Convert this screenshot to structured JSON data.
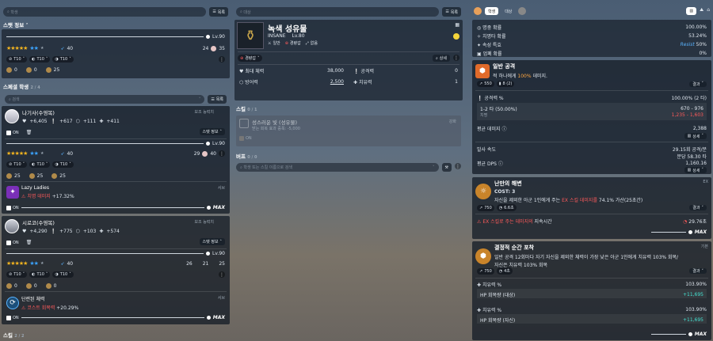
{
  "col1": {
    "search_placeholder": "학생",
    "list_btn": "목록",
    "stat_info_title": "스탯 정보",
    "level": "Lv.90",
    "bond": "40",
    "gift1": "24",
    "gift2": "35",
    "tier1": "T10",
    "tier2": "T10",
    "tier3": "T10",
    "equip_vals": [
      "0",
      "0",
      "25"
    ],
    "special_title": "스페셜 학생",
    "special_count": "2 / 4",
    "search2_placeholder": "검색",
    "list_btn2": "목록",
    "s1": {
      "name": "나기사(수영복)",
      "role": "보조 능력치",
      "stats": [
        "+6,405",
        "+617",
        "+111",
        "+411"
      ],
      "stat_btn": "스탯 정보",
      "on": "ON",
      "level": "Lv.90",
      "bond": "40",
      "gift1": "29",
      "gift2": "40",
      "tiers": [
        "T10",
        "T10",
        "T10"
      ],
      "equip": [
        "25",
        "25",
        "25"
      ],
      "skill_name": "Lazy Ladies",
      "skill_type": "서브",
      "skill_line1": "치명 데미지",
      "skill_line2": "+17.32%",
      "max": "MAX"
    },
    "s2": {
      "name": "시로코(수영복)",
      "role": "보조 능력치",
      "stats": [
        "+4,290",
        "+775",
        "+103",
        "+574"
      ],
      "stat_btn": "스탯 정보",
      "on": "ON",
      "level": "Lv.90",
      "bond": "40",
      "gift1": "26",
      "gift2": "21",
      "gift3": "25",
      "tiers": [
        "T10",
        "T10",
        "T10"
      ],
      "equip": [
        "0",
        "0",
        "0"
      ],
      "skill_name": "단련된 체력",
      "skill_type": "서브",
      "skill_line1": "코스트 회복력",
      "skill_line2": "+20.29%",
      "max": "MAX"
    },
    "skill_footer": "스킬",
    "skill_footer_count": "2 / 2"
  },
  "col2": {
    "search_placeholder": "대상",
    "list_btn": "목록",
    "name": "녹색 성유물",
    "diff": "INSANE",
    "level": "Lv.80",
    "tag1": "일반",
    "tag2": "경량갑",
    "tag3": "없음",
    "armor_tag": "경량갑",
    "detail_btn": "상세",
    "hp_label": "최대 체력",
    "hp_val": "38,000",
    "atk_label": "공격력",
    "atk_val": "0",
    "def_label": "방어력",
    "def_val": "2,500",
    "heal_label": "치유력",
    "heal_val": "1",
    "skill_title": "스킬",
    "skill_count": "0 / 1",
    "skill_name": "성스러운 빛 (성유물)",
    "skill_tag": "강화",
    "skill_desc": "받는 회복 효과 증폭: -5,000",
    "skill_on": "ON",
    "buff_title": "버프",
    "buff_count": "0 / 0",
    "buff_placeholder": "학생 또는 스킬 이름으로 검색"
  },
  "col3": {
    "tab1": "학생",
    "tab2": "대상",
    "stats": [
      {
        "label": "명중 확률",
        "value": "100.00%"
      },
      {
        "label": "치명타 확률",
        "value": "53.24%"
      },
      {
        "label": "속성 특효",
        "extra": "Resist",
        "value": "50%"
      },
      {
        "label": "엄폐 확률",
        "value": "0%"
      }
    ],
    "normal": {
      "title": "일반 공격",
      "desc_pre": "적 하나에게 ",
      "desc_hl": "100%",
      "desc_post": " 데미지.",
      "v1": "550",
      "v2": "8 (2)",
      "result": "결과",
      "acc_label": "공격력 %",
      "acc_val": "100.00% (2 타)",
      "hit_label": "1-2 타 (50.00%)",
      "hit_val": "670 - 976",
      "crit_label": "치명",
      "crit_val": "1,235 - 1,603",
      "avg_label": "평균 데미지",
      "avg_val": "2,388",
      "detail": "상세",
      "rate_label": "발사 속도",
      "rate_val": "29.15회 공격/분",
      "rate_val2": "분당 58.30 타",
      "dps_label": "평균 DPS",
      "dps_val": "1,160.16"
    },
    "ex": {
      "title": "난만의 해변",
      "type": "EX",
      "cost": "COST: 3",
      "desc": "자신을 제외한 아군 1인에게 주는",
      "desc2": "EX 스킬 데미지를",
      "desc3": "74.1% 가산(25초간)",
      "v1": "750",
      "v2": "6.6초",
      "result": "결과",
      "eff": "EX 스킬로 주는 데미지의",
      "eff2": "지속시간",
      "eff_val": "29.76초",
      "max": "MAX"
    },
    "basic": {
      "title": "결정적 순간 포착",
      "type": "기본",
      "desc": "일반 공격 12회마다 자기 자신을 제외한 체력이 가장 낮은 아군 1인에게 치유력 103% 회복/",
      "desc2": "자신은 치유력 103% 회복",
      "v1": "750",
      "v2": "4초",
      "result": "결과",
      "h1_label": "치유력 %",
      "h1_val": "103.90%",
      "h1b_label": "HP 회복량 (대상)",
      "h1b_val": "+11,695",
      "h2_label": "치유력 %",
      "h2_val": "103.90%",
      "h2b_label": "HP 회복량 (자신)",
      "h2b_val": "+11,695",
      "max": "MAX"
    }
  }
}
